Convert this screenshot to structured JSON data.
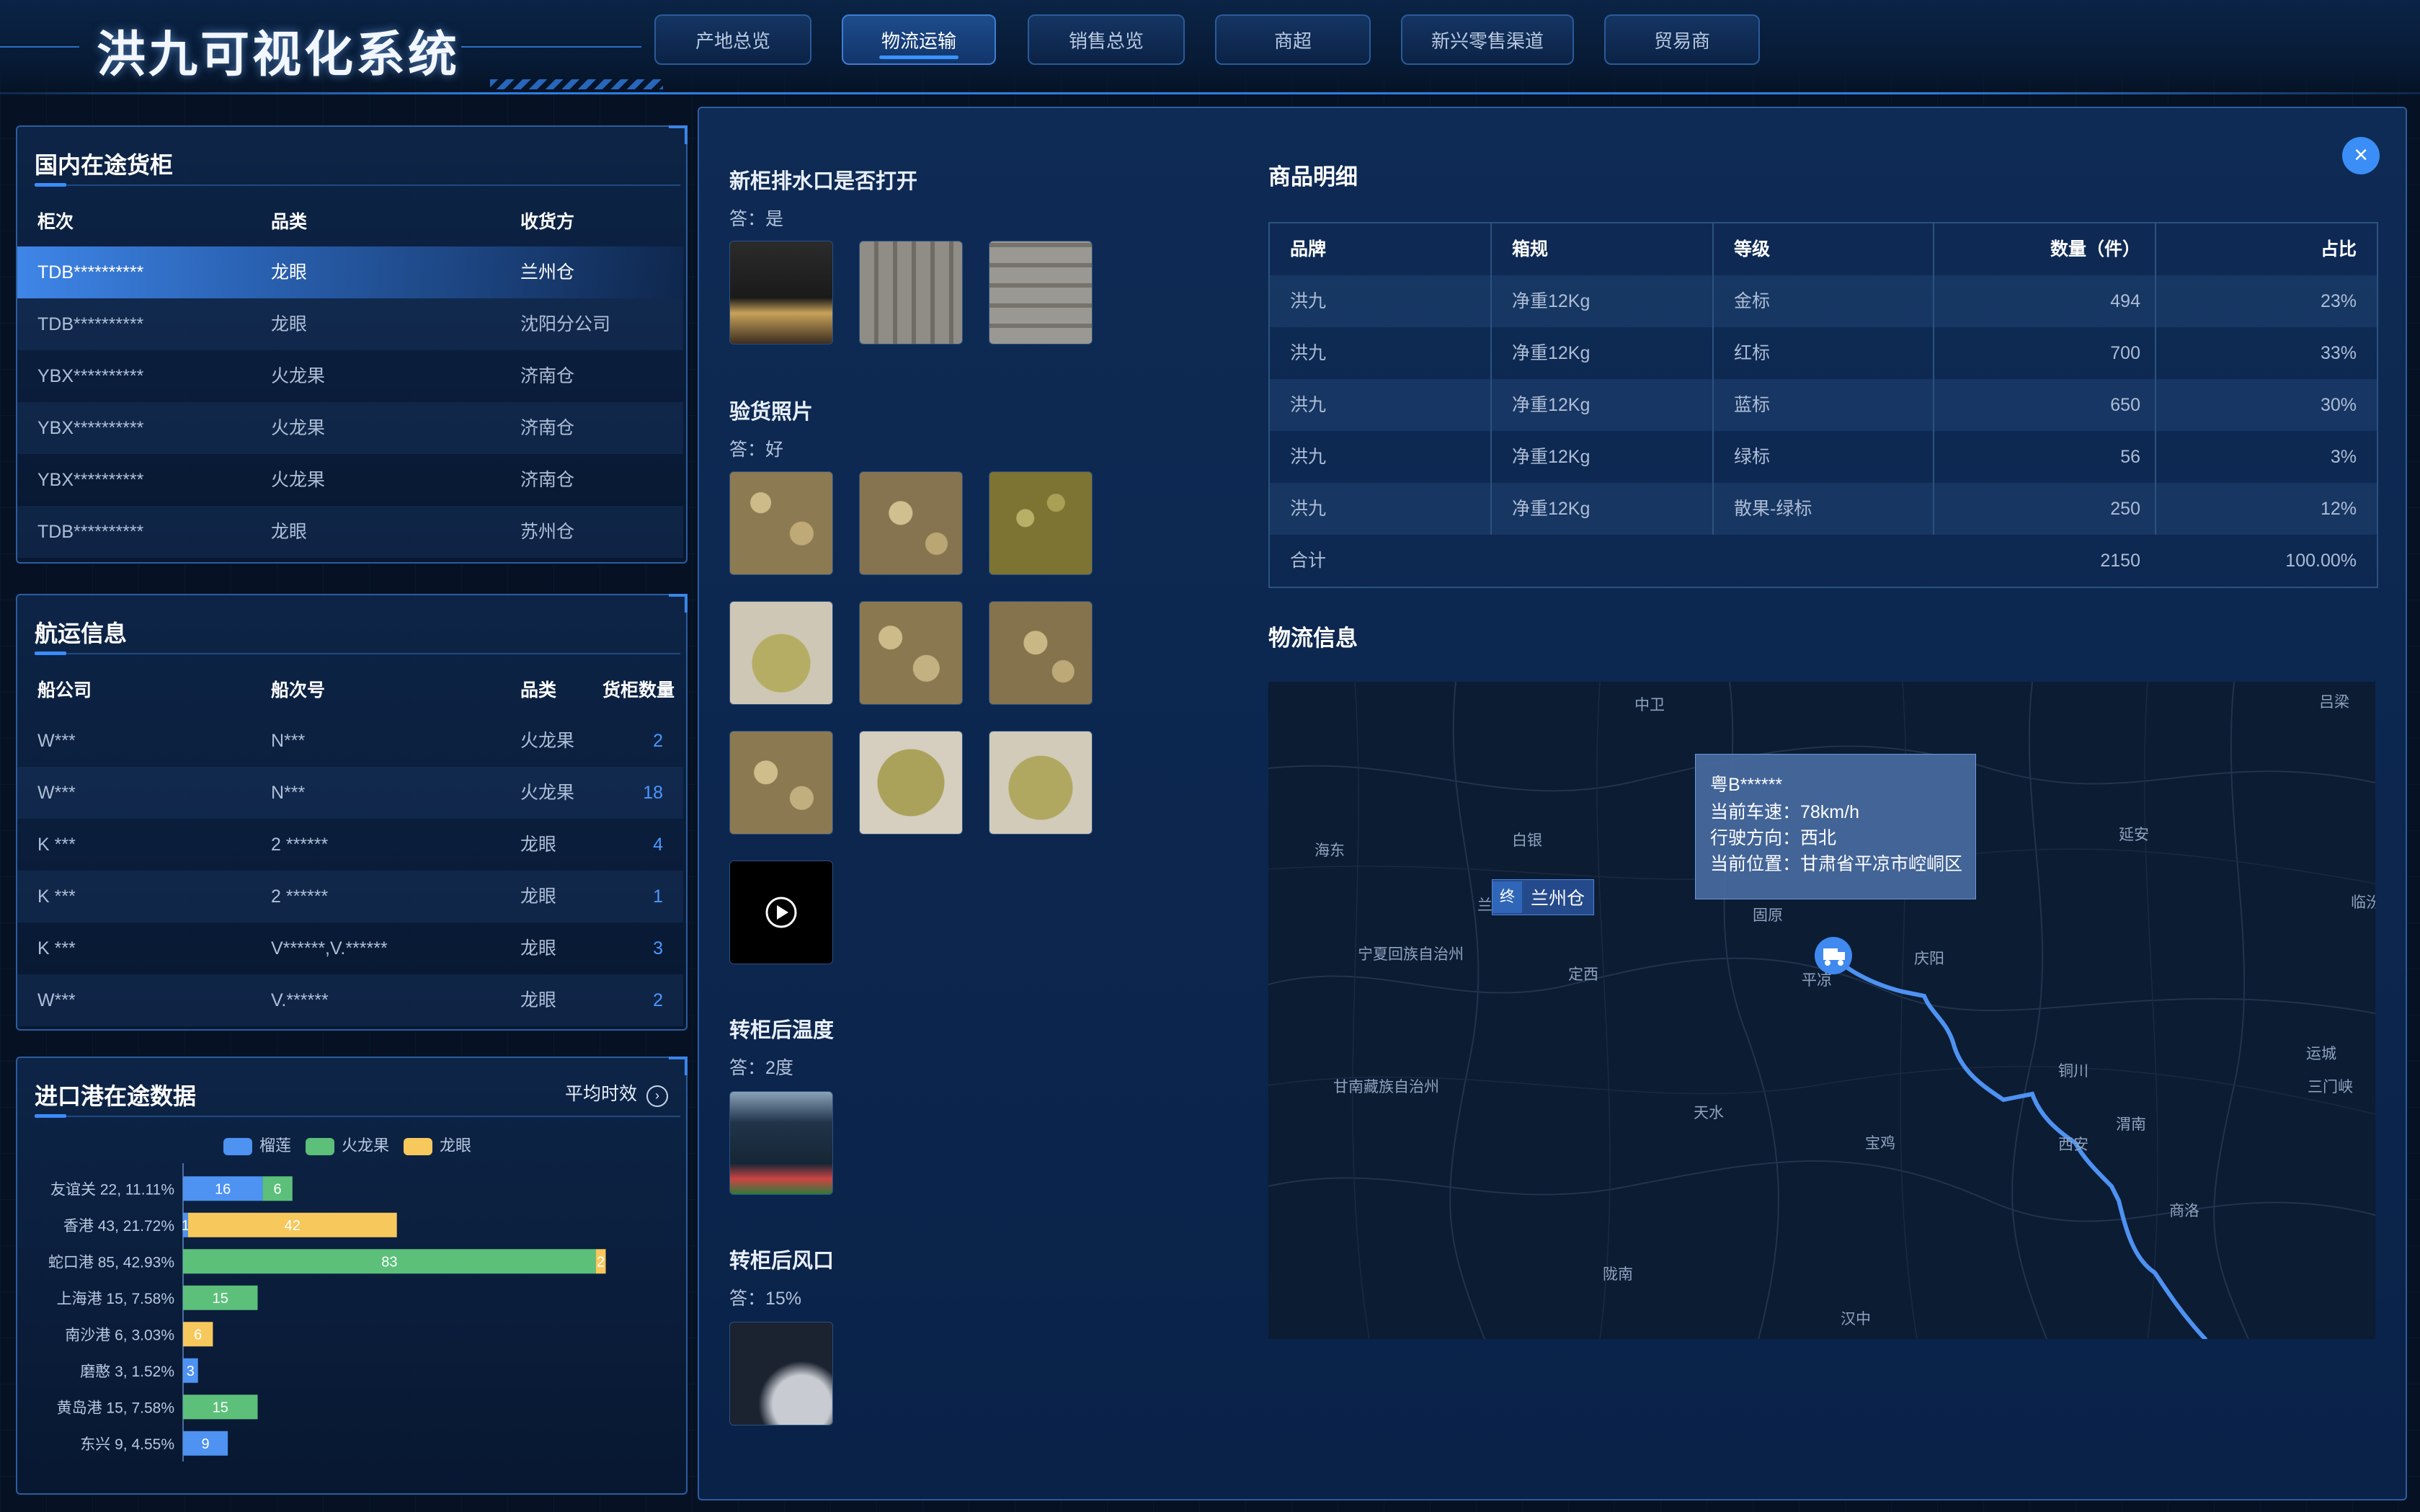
{
  "app": {
    "title": "洪九可视化系统"
  },
  "nav": [
    "产地总览",
    "物流运输",
    "销售总览",
    "商超",
    "新兴零售渠道",
    "贸易商"
  ],
  "nav_active": 1,
  "containers_panel": {
    "title": "国内在途货柜",
    "headers": [
      "柜次",
      "品类",
      "收货方"
    ],
    "rows": [
      [
        "TDB**********",
        "龙眼",
        "兰州仓"
      ],
      [
        "TDB**********",
        "龙眼",
        "沈阳分公司"
      ],
      [
        "YBX**********",
        "火龙果",
        "济南仓"
      ],
      [
        "YBX**********",
        "火龙果",
        "济南仓"
      ],
      [
        "YBX**********",
        "火龙果",
        "济南仓"
      ],
      [
        "TDB**********",
        "龙眼",
        "苏州仓"
      ]
    ],
    "selected_row": 0
  },
  "shipping_panel": {
    "title": "航运信息",
    "headers": [
      "船公司",
      "船次号",
      "品类",
      "货柜数量"
    ],
    "rows": [
      [
        "W***",
        "N***",
        "火龙果",
        "2"
      ],
      [
        "W***",
        "N***",
        "火龙果",
        "18"
      ],
      [
        "K ***",
        "2 ******",
        "龙眼",
        "4"
      ],
      [
        "K ***",
        "2 ******",
        "龙眼",
        "1"
      ],
      [
        "K ***",
        "V******,V.******",
        "龙眼",
        "3"
      ],
      [
        "W***",
        "V.******",
        "龙眼",
        "2"
      ]
    ]
  },
  "ports_panel": {
    "title": "进口港在途数据",
    "action_label": "平均时效"
  },
  "chart_data": {
    "type": "bar",
    "orientation": "horizontal",
    "stacked": true,
    "categories": [
      "友谊关 22, 11.11%",
      "香港 43, 21.72%",
      "蛇口港 85, 42.93%",
      "上海港 15, 7.58%",
      "南沙港 6, 3.03%",
      "磨憨 3, 1.52%",
      "黄岛港 15, 7.58%",
      "东兴 9, 4.55%"
    ],
    "series": [
      {
        "name": "榴莲",
        "color": "#4e92f2",
        "values": [
          16,
          1,
          0,
          0,
          0,
          3,
          0,
          9
        ]
      },
      {
        "name": "火龙果",
        "color": "#5cc07a",
        "values": [
          6,
          0,
          83,
          15,
          0,
          0,
          15,
          0
        ]
      },
      {
        "name": "龙眼",
        "color": "#f7c85c",
        "values": [
          0,
          42,
          2,
          0,
          6,
          0,
          0,
          0
        ]
      }
    ],
    "legend_position": "top-center",
    "grid": false
  },
  "detail": {
    "close_label": "×",
    "q1": {
      "title": "新柜排水口是否打开",
      "answer": "答：是"
    },
    "q2": {
      "title": "验货照片",
      "answer": "答：好"
    },
    "q3": {
      "title": "转柜后温度",
      "answer": "答：2度"
    },
    "q4": {
      "title": "转柜后风口",
      "answer": "答：15%"
    },
    "goods_title": "商品明细",
    "goods_headers": [
      "品牌",
      "箱规",
      "等级",
      "数量（件）",
      "占比"
    ],
    "goods_rows": [
      [
        "洪九",
        "净重12Kg",
        "金标",
        "494",
        "23%"
      ],
      [
        "洪九",
        "净重12Kg",
        "红标",
        "700",
        "33%"
      ],
      [
        "洪九",
        "净重12Kg",
        "蓝标",
        "650",
        "30%"
      ],
      [
        "洪九",
        "净重12Kg",
        "绿标",
        "56",
        "3%"
      ],
      [
        "洪九",
        "净重12Kg",
        "散果-绿标",
        "250",
        "12%"
      ]
    ],
    "goods_total": [
      "合计",
      "2150",
      "100.00%"
    ],
    "logistics_title": "物流信息",
    "map_labels": [
      "中卫",
      "吕梁",
      "海东",
      "白银",
      "延安",
      "固原",
      "庆阳",
      "临汾",
      "宁夏回族自治州",
      "定西",
      "平凉",
      "甘南藏族自治州",
      "天水",
      "铜川",
      "运城",
      "三门峡",
      "宝鸡",
      "西安",
      "渭南",
      "商洛",
      "陇南",
      "汉中",
      "兰"
    ],
    "destination": {
      "tag": "终",
      "name": "兰州仓"
    },
    "vehicle": {
      "plate": "粤B******",
      "speed": "当前车速：78km/h",
      "direction": "行驶方向：西北",
      "location": "当前位置：甘肃省平凉市崆峒区"
    }
  }
}
